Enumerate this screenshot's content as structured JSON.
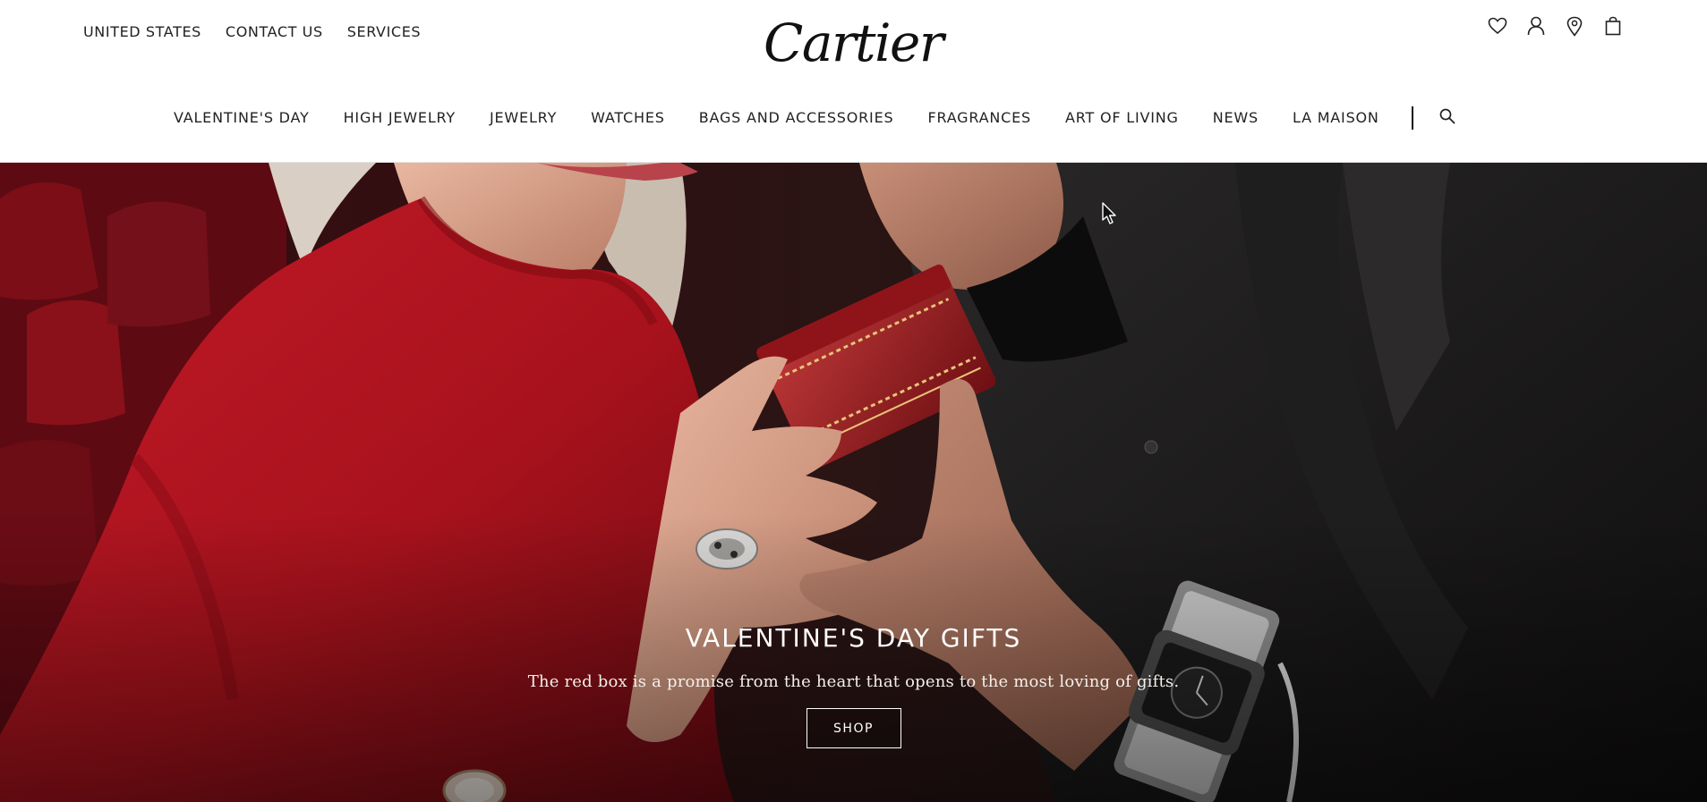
{
  "utility": {
    "links": [
      "UNITED STATES",
      "CONTACT US",
      "SERVICES"
    ]
  },
  "brand": {
    "logo_text": "Cartier"
  },
  "account_icons": [
    "heart-icon",
    "user-icon",
    "location-pin-icon",
    "shopping-bag-icon"
  ],
  "nav": {
    "items": [
      "VALENTINE'S DAY",
      "HIGH JEWELRY",
      "JEWELRY",
      "WATCHES",
      "BAGS AND ACCESSORIES",
      "FRAGRANCES",
      "ART OF LIVING",
      "NEWS",
      "LA MAISON"
    ],
    "search_icon": "search-icon"
  },
  "hero": {
    "title": "VALENTINE'S DAY GIFTS",
    "subtitle": "The red box is a promise from the heart that opens to the most loving of gifts.",
    "cta_label": "SHOP"
  },
  "colors": {
    "hero_red": "#a8121c",
    "hero_dark": "#1b1a1a",
    "text": "#222222",
    "background": "#ffffff"
  }
}
